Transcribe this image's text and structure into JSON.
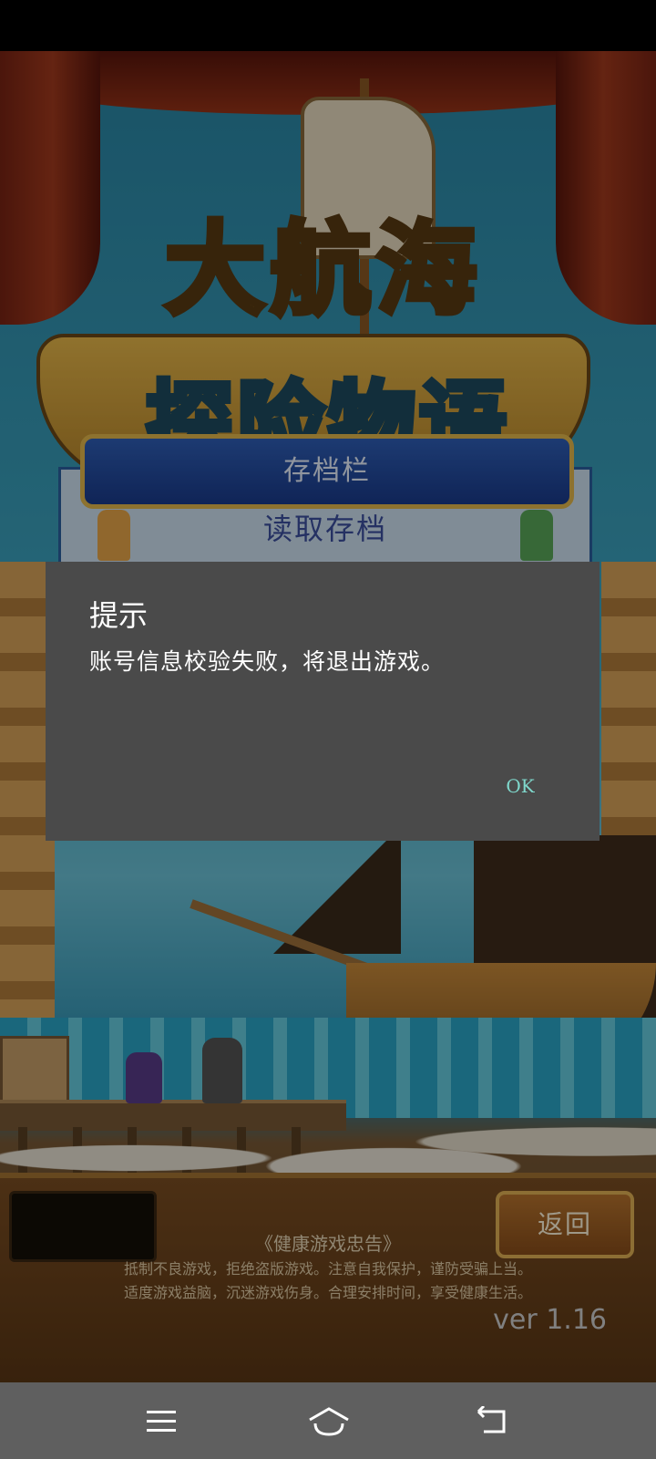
{
  "game": {
    "logo_line1": "大航海",
    "logo_line2": "探险物语",
    "save_slot_header": "存档栏",
    "load_save": "读取存档"
  },
  "footer": {
    "back_label": "返回",
    "health_title": "《健康游戏忠告》",
    "health_line1": "抵制不良游戏，拒绝盗版游戏。注意自我保护，谨防受骗上当。",
    "health_line2": "适度游戏益脑，沉迷游戏伤身。合理安排时间，享受健康生活。",
    "version": "ver 1.16"
  },
  "dialog": {
    "title": "提示",
    "message": "账号信息校验失败，将退出游戏。",
    "ok_label": "OK"
  },
  "navbar": {
    "icons": [
      "menu-icon",
      "home-icon",
      "back-icon"
    ]
  },
  "colors": {
    "dialog_bg": "#4a4a4a",
    "ok_text": "#7fd8cc",
    "navbar_bg": "#5f5f5f"
  }
}
